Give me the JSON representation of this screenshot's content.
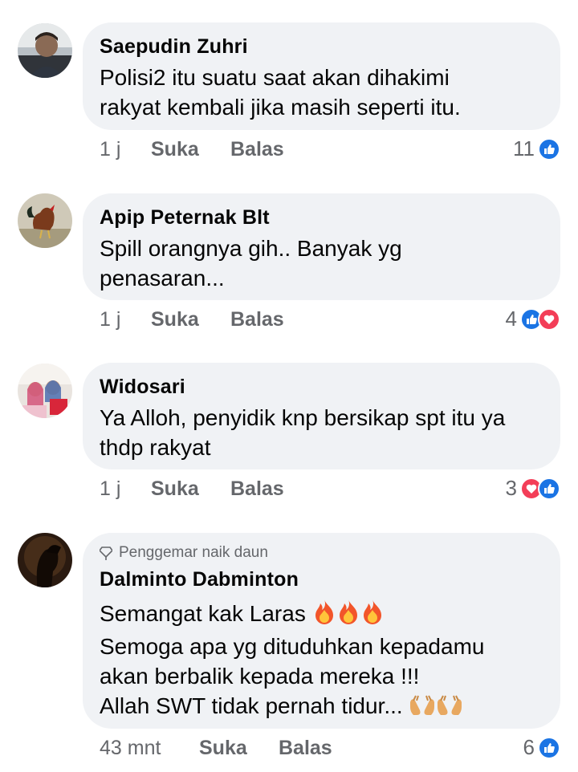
{
  "comments": [
    {
      "name": "Saepudin Zuhri",
      "lines": [
        "Polisi2 itu suatu saat akan dihakimi",
        "rakyat kembali jika masih seperti itu."
      ],
      "time": "1 j",
      "like_label": "Suka",
      "reply_label": "Balas",
      "reaction_count": "11",
      "reactions": [
        "like-icon"
      ]
    },
    {
      "name": "Apip Peternak Blt",
      "lines": [
        "Spill orangnya gih.. Banyak yg",
        "penasaran..."
      ],
      "time": "1 j",
      "like_label": "Suka",
      "reply_label": "Balas",
      "reaction_count": "4",
      "reactions": [
        "like-icon",
        "love-icon"
      ]
    },
    {
      "name": "Widosari",
      "lines": [
        "Ya Alloh, penyidik knp bersikap spt itu ya",
        "thdp rakyat"
      ],
      "time": "1 j",
      "like_label": "Suka",
      "reply_label": "Balas",
      "reaction_count": "3",
      "reactions": [
        "love-icon",
        "like-icon"
      ]
    },
    {
      "badge": "Penggemar naik daun",
      "name": "Dalminto Dabminton",
      "lines": [
        "Semangat kak Laras",
        "Semoga apa yg dituduhkan kepadamu",
        "akan berbalik kepada mereka !!!",
        "Allah SWT tidak pernah tidur..."
      ],
      "time": "43 mnt",
      "like_label": "Suka",
      "reply_label": "Balas",
      "reaction_count": "6",
      "reactions": [
        "like-icon"
      ]
    }
  ],
  "colors": {
    "like": "#1b74e4",
    "love": "#f33e58",
    "bubble": "#f0f2f5",
    "meta": "#65676b"
  }
}
